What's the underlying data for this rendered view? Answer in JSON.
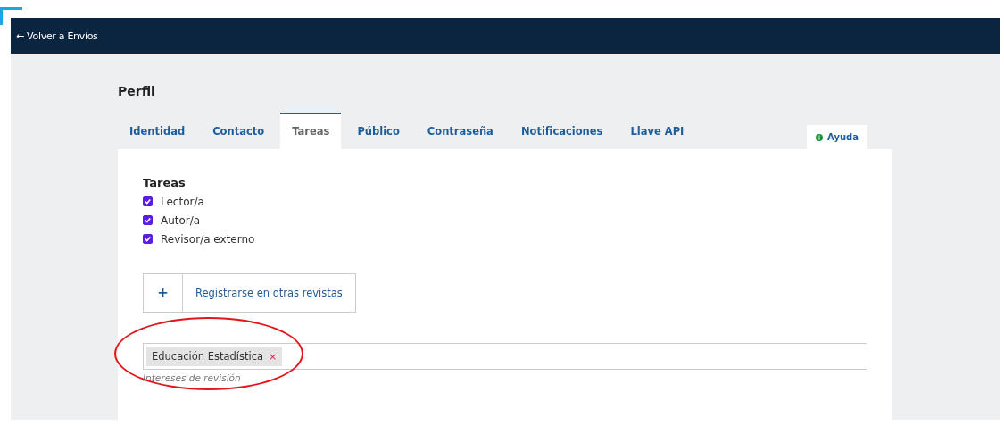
{
  "topbar": {
    "back_link": "← Volver a Envíos"
  },
  "page_title": "Perfil",
  "tabs": [
    {
      "label": "Identidad",
      "selected": false
    },
    {
      "label": "Contacto",
      "selected": false
    },
    {
      "label": "Tareas",
      "selected": true
    },
    {
      "label": "Público",
      "selected": false
    },
    {
      "label": "Contraseña",
      "selected": false
    },
    {
      "label": "Notificaciones",
      "selected": false
    },
    {
      "label": "Llave API",
      "selected": false
    }
  ],
  "help": {
    "label": "Ayuda"
  },
  "roles": {
    "heading": "Tareas",
    "items": [
      {
        "label": "Lector/a",
        "checked": true
      },
      {
        "label": "Autor/a",
        "checked": true
      },
      {
        "label": "Revisor/a externo",
        "checked": true
      }
    ]
  },
  "register_button": {
    "icon": "+",
    "label": "Registrarse en otras revistas"
  },
  "interests": {
    "tags": [
      {
        "label": "Educación Estadística",
        "remove": "×"
      }
    ],
    "caption": "Intereses de revisión"
  }
}
